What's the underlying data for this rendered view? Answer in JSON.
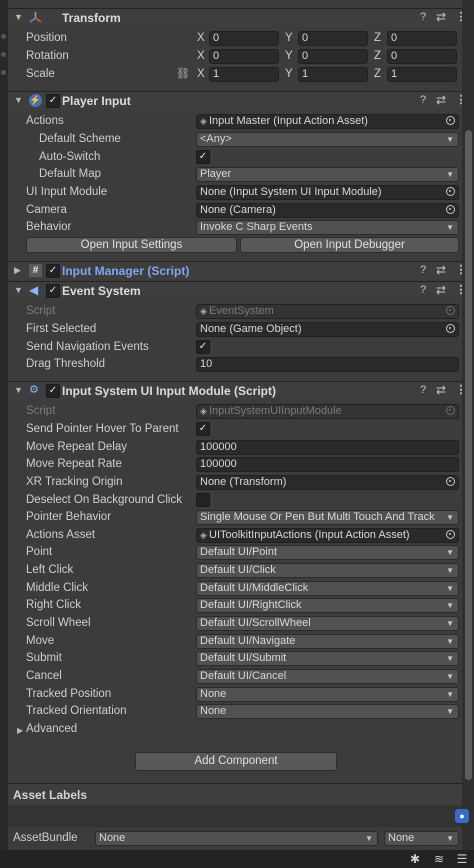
{
  "transform": {
    "title": "Transform",
    "position_label": "Position",
    "rotation_label": "Rotation",
    "scale_label": "Scale",
    "axis_x": "X",
    "axis_y": "Y",
    "axis_z": "Z",
    "position": [
      "0",
      "0",
      "0"
    ],
    "rotation": [
      "0",
      "0",
      "0"
    ],
    "scale": [
      "1",
      "1",
      "1"
    ]
  },
  "player_input": {
    "title": "Player Input",
    "actions_label": "Actions",
    "actions_value": "Input Master (Input Action Asset)",
    "default_scheme_label": "Default Scheme",
    "default_scheme_value": "<Any>",
    "auto_switch_label": "Auto-Switch",
    "default_map_label": "Default Map",
    "default_map_value": "Player",
    "ui_module_label": "UI Input Module",
    "ui_module_value": "None (Input System UI Input Module)",
    "camera_label": "Camera",
    "camera_value": "None (Camera)",
    "behavior_label": "Behavior",
    "behavior_value": "Invoke C Sharp Events",
    "open_settings": "Open Input Settings",
    "open_debugger": "Open Input Debugger"
  },
  "input_manager": {
    "title": "Input Manager (Script)"
  },
  "event_system": {
    "title": "Event System",
    "script_label": "Script",
    "script_value": "EventSystem",
    "first_selected_label": "First Selected",
    "first_selected_value": "None (Game Object)",
    "send_nav_label": "Send Navigation Events",
    "drag_threshold_label": "Drag Threshold",
    "drag_threshold_value": "10"
  },
  "ui_module": {
    "title": "Input System UI Input Module (Script)",
    "script_label": "Script",
    "script_value": "InputSystemUIInputModule",
    "hover_label": "Send Pointer Hover To Parent",
    "repeat_delay_label": "Move Repeat Delay",
    "repeat_delay_value": "100000",
    "repeat_rate_label": "Move Repeat Rate",
    "repeat_rate_value": "100000",
    "xr_label": "XR Tracking Origin",
    "xr_value": "None (Transform)",
    "deselect_label": "Deselect On Background Click",
    "pointer_behavior_label": "Pointer Behavior",
    "pointer_behavior_value": "Single Mouse Or Pen But Multi Touch And Track",
    "actions_asset_label": "Actions Asset",
    "actions_asset_value": "UIToolkitInputActions (Input Action Asset)",
    "point_label": "Point",
    "point_value": "Default UI/Point",
    "left_click_label": "Left Click",
    "left_click_value": "Default UI/Click",
    "middle_click_label": "Middle Click",
    "middle_click_value": "Default UI/MiddleClick",
    "right_click_label": "Right Click",
    "right_click_value": "Default UI/RightClick",
    "scroll_label": "Scroll Wheel",
    "scroll_value": "Default UI/ScrollWheel",
    "move_label": "Move",
    "move_value": "Default UI/Navigate",
    "submit_label": "Submit",
    "submit_value": "Default UI/Submit",
    "cancel_label": "Cancel",
    "cancel_value": "Default UI/Cancel",
    "tracked_pos_label": "Tracked Position",
    "tracked_pos_value": "None",
    "tracked_orient_label": "Tracked Orientation",
    "tracked_orient_value": "None",
    "advanced_label": "Advanced"
  },
  "add_component": "Add Component",
  "asset_labels": {
    "title": "Asset Labels",
    "bundle_label": "AssetBundle",
    "bundle_value": "None",
    "variant_value": "None"
  },
  "icons": {
    "transform": "transform-axes-icon",
    "player_input": "player-input-icon",
    "script": "csharp-script-icon",
    "event_system": "event-system-icon",
    "ui_module": "input-module-icon",
    "help": "help-icon",
    "preset": "preset-icon",
    "more": "kebab-menu-icon",
    "tag": "tag-icon"
  },
  "colors": {
    "link": "#7fa6ef",
    "panel": "#3c3c3c",
    "field": "#2a2a2a",
    "button": "#585858"
  }
}
